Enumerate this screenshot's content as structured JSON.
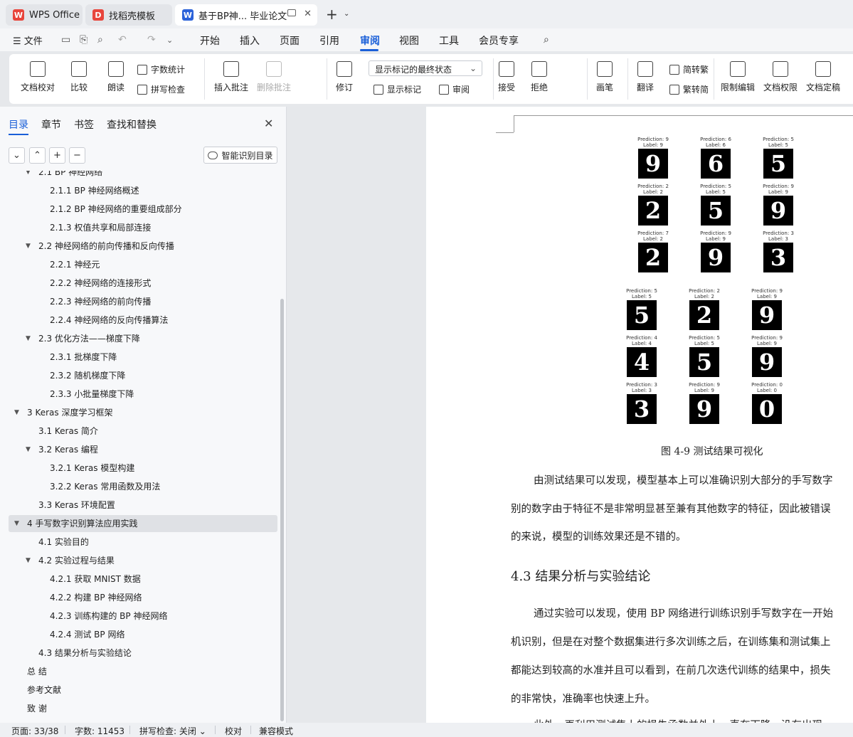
{
  "tabs": [
    {
      "label": "WPS Office",
      "icon": "wps-logo-icon",
      "color": "#e8453c"
    },
    {
      "label": "找稻壳模板",
      "icon": "docer-logo-icon",
      "color": "#e8453c"
    },
    {
      "label": "基于BP神... 毕业论文",
      "icon": "word-doc-icon",
      "color": "#2b62d9"
    }
  ],
  "menu": {
    "file": "文件",
    "items": [
      "开始",
      "插入",
      "页面",
      "引用",
      "审阅",
      "视图",
      "工具",
      "会员专享"
    ],
    "active": "审阅"
  },
  "ribbon": {
    "doc_check": "文档校对",
    "compare": "比较",
    "read_aloud": "朗读",
    "word_count": "字数统计",
    "spell_check": "拼写检查",
    "insert_comment": "插入批注",
    "delete_comment": "删除批注",
    "track_changes": "修订",
    "display_state": "显示标记的最终状态",
    "show_markup": "显示标记",
    "review": "审阅",
    "accept": "接受",
    "reject": "拒绝",
    "pen": "画笔",
    "translate": "翻译",
    "to_traditional": "简转繁",
    "to_simplified": "繁转简",
    "restrict_edit": "限制编辑",
    "doc_permission": "文档权限",
    "doc_finalize": "文档定稿"
  },
  "panel": {
    "tabs": [
      "目录",
      "章节",
      "书签",
      "查找和替换"
    ],
    "smart_toc": "智能识别目录"
  },
  "toc": [
    {
      "level": 2,
      "label": "2.1 BP 神经网络",
      "caret": true
    },
    {
      "level": 3,
      "label": "2.1.1 BP 神经网络概述"
    },
    {
      "level": 3,
      "label": "2.1.2 BP 神经网络的重要组成部分"
    },
    {
      "level": 3,
      "label": "2.1.3  权值共享和局部连接"
    },
    {
      "level": 2,
      "label": "2.2  神经网络的前向传播和反向传播",
      "caret": true
    },
    {
      "level": 3,
      "label": "2.2.1  神经元"
    },
    {
      "level": 3,
      "label": "2.2.2  神经网络的连接形式"
    },
    {
      "level": 3,
      "label": "2.2.3  神经网络的前向传播"
    },
    {
      "level": 3,
      "label": "2.2.4  神经网络的反向传播算法"
    },
    {
      "level": 2,
      "label": "2.3  优化方法——梯度下降",
      "caret": true
    },
    {
      "level": 3,
      "label": "2.3.1  批梯度下降"
    },
    {
      "level": 3,
      "label": "2.3.2  随机梯度下降"
    },
    {
      "level": 3,
      "label": "2.3.3  小批量梯度下降"
    },
    {
      "level": 1,
      "label": "3 Keras 深度学习框架",
      "caret": true
    },
    {
      "level": 2,
      "label": "3.1 Keras 简介"
    },
    {
      "level": 2,
      "label": "3.2 Keras 编程",
      "caret": true
    },
    {
      "level": 3,
      "label": "3.2.1 Keras 模型构建"
    },
    {
      "level": 3,
      "label": "3.2.2 Keras 常用函数及用法"
    },
    {
      "level": 2,
      "label": "3.3 Keras 环境配置"
    },
    {
      "level": 1,
      "label": "4  手写数字识别算法应用实践",
      "caret": true,
      "selected": true
    },
    {
      "level": 2,
      "label": "4.1 实验目的"
    },
    {
      "level": 2,
      "label": "4.2 实验过程与结果",
      "caret": true
    },
    {
      "level": 3,
      "label": "4.2.1 获取 MNIST 数据"
    },
    {
      "level": 3,
      "label": "4.2.2 构建 BP 神经网络"
    },
    {
      "level": 3,
      "label": "4.2.3 训练构建的 BP 神经网络"
    },
    {
      "level": 3,
      "label": "4.2.4 测试 BP 网络"
    },
    {
      "level": 2,
      "label": "4.3 结果分析与实验结论"
    },
    {
      "level": 1,
      "label": "总    结"
    },
    {
      "level": 1,
      "label": "参考文献"
    },
    {
      "level": 1,
      "label": "致    谢"
    }
  ],
  "figure": {
    "group1": [
      {
        "pred": "Prediction: 9",
        "label": "Label: 9",
        "digit": "9"
      },
      {
        "pred": "Prediction: 6",
        "label": "Label: 6",
        "digit": "6"
      },
      {
        "pred": "Prediction: 5",
        "label": "Label: 5",
        "digit": "5"
      },
      {
        "pred": "Prediction: 2",
        "label": "Label: 2",
        "digit": "2"
      },
      {
        "pred": "Prediction: 5",
        "label": "Label: 5",
        "digit": "5"
      },
      {
        "pred": "Prediction: 9",
        "label": "Label: 9",
        "digit": "9"
      },
      {
        "pred": "Prediction: 7",
        "label": "Label: 2",
        "digit": "2"
      },
      {
        "pred": "Prediction: 9",
        "label": "Label: 9",
        "digit": "9"
      },
      {
        "pred": "Prediction: 3",
        "label": "Label: 3",
        "digit": "3"
      }
    ],
    "group2": [
      {
        "pred": "Prediction: 5",
        "label": "Label: 5",
        "digit": "5"
      },
      {
        "pred": "Prediction: 2",
        "label": "Label: 2",
        "digit": "2"
      },
      {
        "pred": "Prediction: 9",
        "label": "Label: 9",
        "digit": "9"
      },
      {
        "pred": "Prediction: 4",
        "label": "Label: 4",
        "digit": "4"
      },
      {
        "pred": "Prediction: 5",
        "label": "Label: 5",
        "digit": "5"
      },
      {
        "pred": "Prediction: 9",
        "label": "Label: 9",
        "digit": "9"
      },
      {
        "pred": "Prediction: 3",
        "label": "Label: 3",
        "digit": "3"
      },
      {
        "pred": "Prediction: 9",
        "label": "Label: 9",
        "digit": "9"
      },
      {
        "pred": "Prediction: 0",
        "label": "Label: 0",
        "digit": "0"
      }
    ],
    "caption": "图 4-9  测试结果可视化"
  },
  "body": {
    "p1": [
      "由测试结果可以发现，模型基本上可以准确识别大部分的手写数字",
      "别的数字由于特征不是非常明显甚至兼有其他数字的特征，因此被错误",
      "的来说，模型的训练效果还是不错的。"
    ],
    "heading": "4.3 结果分析与实验结论",
    "p2": [
      "通过实验可以发现，使用 BP 网络进行训练识别手写数字在一开始",
      "机识别，但是在对整个数据集进行多次训练之后，在训练集和测试集上",
      "都能达到较高的水准并且可以看到，在前几次迭代训练的结果中，损失",
      "的非常快，准确率也快速上升。",
      "此外，再利用测试集上的损失函数并外上一直在下降，没有出现"
    ]
  },
  "status": {
    "page": "页面: 33/38",
    "words": "字数: 11453",
    "spell": "拼写检查: 关闭",
    "proof": "校对",
    "compat": "兼容模式"
  }
}
